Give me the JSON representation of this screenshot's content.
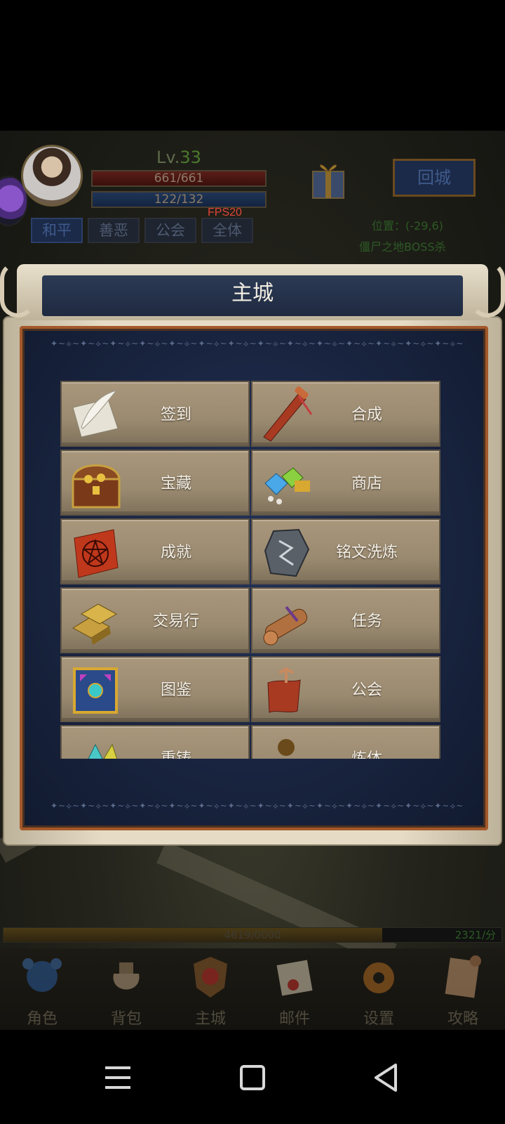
{
  "hud": {
    "level_prefix": "Lv.",
    "level_value": "33",
    "hp": "661/661",
    "mp": "122/132",
    "fps": "FPS20",
    "modes": [
      "和平",
      "善恶",
      "公会",
      "全体"
    ],
    "return_button": "回城",
    "position": "位置：(-29,6)",
    "map_name": "僵尸之地BOSS杀"
  },
  "dialog": {
    "title": "主城",
    "items": [
      {
        "label": "签到",
        "icon": "quill-paper-icon"
      },
      {
        "label": "合成",
        "icon": "red-scroll-icon"
      },
      {
        "label": "宝藏",
        "icon": "treasure-chest-icon"
      },
      {
        "label": "商店",
        "icon": "gems-icon"
      },
      {
        "label": "成就",
        "icon": "pentagram-scroll-icon"
      },
      {
        "label": "铭文洗炼",
        "icon": "rune-stone-icon"
      },
      {
        "label": "交易行",
        "icon": "gold-bars-icon"
      },
      {
        "label": "任务",
        "icon": "quest-scroll-icon"
      },
      {
        "label": "图鉴",
        "icon": "codex-book-icon"
      },
      {
        "label": "公会",
        "icon": "guild-banner-icon"
      },
      {
        "label": "重铸",
        "icon": "crystal-icon"
      },
      {
        "label": "炼体",
        "icon": "silhouette-icon"
      }
    ]
  },
  "exp": {
    "text": "4619/0000",
    "rate": "2321/分",
    "fill_fraction": 0.76
  },
  "bottom_nav": [
    {
      "label": "角色",
      "icon": "character-orb-icon"
    },
    {
      "label": "背包",
      "icon": "bag-icon"
    },
    {
      "label": "主城",
      "icon": "city-shield-icon"
    },
    {
      "label": "邮件",
      "icon": "mail-icon"
    },
    {
      "label": "设置",
      "icon": "gear-icon"
    },
    {
      "label": "攻略",
      "icon": "guide-scroll-icon"
    }
  ],
  "colors": {
    "dialog_bg": "#1f2a47",
    "dialog_border": "#a4582a",
    "menu_tile": "#9a8a70",
    "menu_text": "#f4efe6",
    "fps": "#e0463a"
  }
}
